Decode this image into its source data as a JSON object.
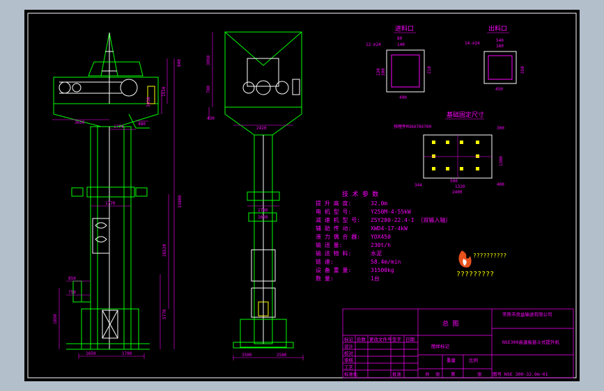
{
  "views": {
    "feed_hole_title": "进料口",
    "discharge_hole_title": "出料口",
    "foundation_title": "基础固定尺寸"
  },
  "dimensions": {
    "left_view": {
      "top_a": "840",
      "top_b": "1510",
      "w_3650": "3650",
      "w_1774": "1774",
      "w_480": "480",
      "mid": "1770",
      "w_1650": "1650",
      "w_1780": "1780",
      "h_main": "33800",
      "h_26520": "26520",
      "h_5770": "5770",
      "h_1850": "1850",
      "w_850": "850",
      "w_750": "750",
      "h_3030": "3030"
    },
    "front_view": {
      "h_3050": "3050",
      "h_780": "780",
      "h_430": "430",
      "w_2420": "2420",
      "w_1780": "1780",
      "w_1650": "1650",
      "w_3500": "3500",
      "w_2580": "2580"
    },
    "feed_hole": {
      "holes": "12-∅24",
      "w_80": "80",
      "w_140": "140",
      "h_130": "130",
      "h_300": "300",
      "h_210": "210",
      "w_490": "490"
    },
    "discharge_hole": {
      "holes": "14-∅24",
      "w_160": "160",
      "w_540": "540",
      "h_350": "350",
      "w_450": "450"
    },
    "foundation": {
      "bolt": "预埋件M36X70X700",
      "w_300": "300",
      "h_1300": "1300",
      "h_400": "400",
      "w_500": "500",
      "w_1320": "1320",
      "w_344": "344",
      "w_2400": "2400"
    }
  },
  "specs": {
    "title": "技 术 参 数",
    "rows": [
      {
        "label": "提 升 高 度:",
        "value": "32.0m"
      },
      {
        "label": "电 机 型 号:",
        "value": "Y250M-4-55kW"
      },
      {
        "label": "减 速 机 型 号:",
        "value": "ZSY280-22.4-I （双输入轴）"
      },
      {
        "label": "辅 助 传 动:",
        "value": "XWD4-17-4kW"
      },
      {
        "label": "液 力 偶 合 器:",
        "value": "YOX450"
      },
      {
        "label": "输 送 量:",
        "value": "230t/h"
      },
      {
        "label": "输 送 物 料:",
        "value": "水泥"
      },
      {
        "label": "链 速:",
        "value": "58.4m/min"
      },
      {
        "label": "设 备 重 量:",
        "value": "31500kg"
      },
      {
        "label": "数 量:",
        "value": "1台"
      }
    ]
  },
  "watermark": {
    "line1": "??????????",
    "line2": "?????????"
  },
  "title_block": {
    "company": "常熟市良益输送有限公司",
    "drawing_name": "总 图",
    "product": "NSE300高速板链斗式提升机",
    "drawing_no": "图号 NSE 300-32.0m-01",
    "scale_hdr": "图样标记",
    "weight_hdr": "重量",
    "ratio_hdr": "比例",
    "cells": [
      "标记",
      "处数",
      "更改文件号",
      "签字",
      "日期",
      "设计",
      "校对",
      "审核",
      "工艺",
      "标准化",
      "批准",
      "共",
      "张",
      "第",
      "张"
    ]
  },
  "colors": {
    "structure": "#00ff00",
    "dimension": "#ff00ff",
    "detail": "#ffffff",
    "accent": "#ffff00",
    "background": "#000000",
    "frame": "#b4bfcc"
  }
}
